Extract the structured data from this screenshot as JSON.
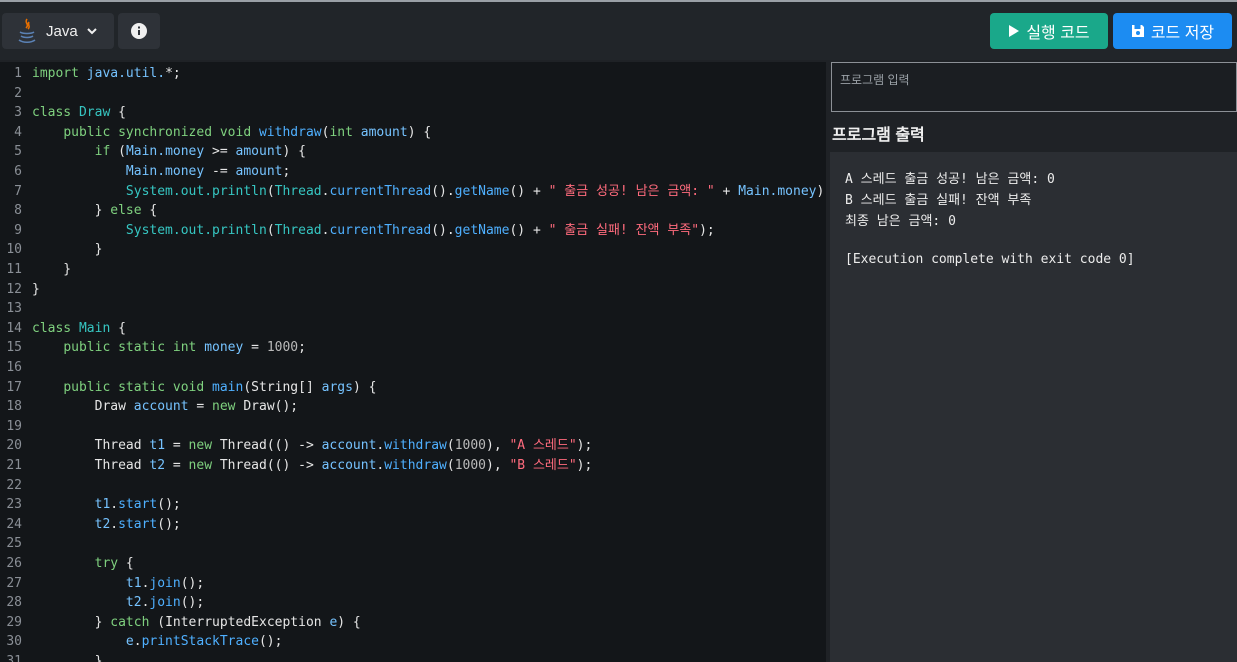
{
  "toolbar": {
    "language": "Java",
    "run_label": "실행 코드",
    "save_label": "코드 저장",
    "colors": {
      "run": "#1aa88a",
      "save": "#1c8cf2"
    }
  },
  "editor": {
    "lines": [
      {
        "n": "1",
        "tokens": [
          [
            "kg",
            "import "
          ],
          [
            "kw",
            "java.util."
          ],
          [
            "op",
            "*;"
          ]
        ]
      },
      {
        "n": "2",
        "tokens": []
      },
      {
        "n": "3",
        "tokens": [
          [
            "kg",
            "class "
          ],
          [
            "cls",
            "Draw"
          ],
          [
            "op",
            " {"
          ]
        ]
      },
      {
        "n": "4",
        "tokens": [
          [
            "op",
            "    "
          ],
          [
            "kg",
            "public synchronized void "
          ],
          [
            "fn",
            "withdraw"
          ],
          [
            "op",
            "("
          ],
          [
            "kg",
            "int "
          ],
          [
            "kw",
            "amount"
          ],
          [
            "op",
            ") {"
          ]
        ]
      },
      {
        "n": "5",
        "tokens": [
          [
            "op",
            "        "
          ],
          [
            "kg",
            "if "
          ],
          [
            "op",
            "("
          ],
          [
            "kw",
            "Main.money"
          ],
          [
            "op",
            " >= "
          ],
          [
            "kw",
            "amount"
          ],
          [
            "op",
            ") {"
          ]
        ]
      },
      {
        "n": "6",
        "tokens": [
          [
            "op",
            "            "
          ],
          [
            "kw",
            "Main.money"
          ],
          [
            "op",
            " -= "
          ],
          [
            "kw",
            "amount"
          ],
          [
            "op",
            ";"
          ]
        ]
      },
      {
        "n": "7",
        "tokens": [
          [
            "op",
            "            "
          ],
          [
            "cls",
            "System.out.println"
          ],
          [
            "op",
            "("
          ],
          [
            "cls",
            "Thread"
          ],
          [
            "op",
            "."
          ],
          [
            "fn",
            "currentThread"
          ],
          [
            "op",
            "()."
          ],
          [
            "fn",
            "getName"
          ],
          [
            "op",
            "() + "
          ],
          [
            "str",
            "\" 출금 성공! 남은 금액: \""
          ],
          [
            "op",
            " + "
          ],
          [
            "kw",
            "Main.money"
          ],
          [
            "op",
            ");"
          ]
        ]
      },
      {
        "n": "8",
        "tokens": [
          [
            "op",
            "        } "
          ],
          [
            "kg",
            "else"
          ],
          [
            "op",
            " {"
          ]
        ]
      },
      {
        "n": "9",
        "tokens": [
          [
            "op",
            "            "
          ],
          [
            "cls",
            "System.out.println"
          ],
          [
            "op",
            "("
          ],
          [
            "cls",
            "Thread"
          ],
          [
            "op",
            "."
          ],
          [
            "fn",
            "currentThread"
          ],
          [
            "op",
            "()."
          ],
          [
            "fn",
            "getName"
          ],
          [
            "op",
            "() + "
          ],
          [
            "str",
            "\" 출금 실패! 잔액 부족\""
          ],
          [
            "op",
            ");"
          ]
        ]
      },
      {
        "n": "10",
        "tokens": [
          [
            "op",
            "        }"
          ]
        ]
      },
      {
        "n": "11",
        "tokens": [
          [
            "op",
            "    }"
          ]
        ]
      },
      {
        "n": "12",
        "tokens": [
          [
            "op",
            "}"
          ]
        ]
      },
      {
        "n": "13",
        "tokens": []
      },
      {
        "n": "14",
        "tokens": [
          [
            "kg",
            "class "
          ],
          [
            "cls",
            "Main"
          ],
          [
            "op",
            " {"
          ]
        ]
      },
      {
        "n": "15",
        "tokens": [
          [
            "op",
            "    "
          ],
          [
            "kg",
            "public static int "
          ],
          [
            "kw",
            "money"
          ],
          [
            "op",
            " = "
          ],
          [
            "num",
            "1000"
          ],
          [
            "op",
            ";"
          ]
        ]
      },
      {
        "n": "16",
        "tokens": []
      },
      {
        "n": "17",
        "tokens": [
          [
            "op",
            "    "
          ],
          [
            "kg",
            "public static void "
          ],
          [
            "fn",
            "main"
          ],
          [
            "op",
            "(String[] "
          ],
          [
            "kw",
            "args"
          ],
          [
            "op",
            ") {"
          ]
        ]
      },
      {
        "n": "18",
        "tokens": [
          [
            "op",
            "        Draw "
          ],
          [
            "kw",
            "account"
          ],
          [
            "op",
            " = "
          ],
          [
            "kg",
            "new "
          ],
          [
            "op",
            "Draw();"
          ]
        ]
      },
      {
        "n": "19",
        "tokens": []
      },
      {
        "n": "20",
        "tokens": [
          [
            "op",
            "        Thread "
          ],
          [
            "kw",
            "t1"
          ],
          [
            "op",
            " = "
          ],
          [
            "kg",
            "new "
          ],
          [
            "op",
            "Thread(() -> "
          ],
          [
            "kw",
            "account"
          ],
          [
            "op",
            "."
          ],
          [
            "fn",
            "withdraw"
          ],
          [
            "op",
            "("
          ],
          [
            "num",
            "1000"
          ],
          [
            "op",
            "), "
          ],
          [
            "str",
            "\"A 스레드\""
          ],
          [
            "op",
            ");"
          ]
        ]
      },
      {
        "n": "21",
        "tokens": [
          [
            "op",
            "        Thread "
          ],
          [
            "kw",
            "t2"
          ],
          [
            "op",
            " = "
          ],
          [
            "kg",
            "new "
          ],
          [
            "op",
            "Thread(() -> "
          ],
          [
            "kw",
            "account"
          ],
          [
            "op",
            "."
          ],
          [
            "fn",
            "withdraw"
          ],
          [
            "op",
            "("
          ],
          [
            "num",
            "1000"
          ],
          [
            "op",
            "), "
          ],
          [
            "str",
            "\"B 스레드\""
          ],
          [
            "op",
            ");"
          ]
        ]
      },
      {
        "n": "22",
        "tokens": []
      },
      {
        "n": "23",
        "tokens": [
          [
            "op",
            "        "
          ],
          [
            "kw",
            "t1"
          ],
          [
            "op",
            "."
          ],
          [
            "fn",
            "start"
          ],
          [
            "op",
            "();"
          ]
        ]
      },
      {
        "n": "24",
        "tokens": [
          [
            "op",
            "        "
          ],
          [
            "kw",
            "t2"
          ],
          [
            "op",
            "."
          ],
          [
            "fn",
            "start"
          ],
          [
            "op",
            "();"
          ]
        ]
      },
      {
        "n": "25",
        "tokens": []
      },
      {
        "n": "26",
        "tokens": [
          [
            "op",
            "        "
          ],
          [
            "kg",
            "try"
          ],
          [
            "op",
            " {"
          ]
        ]
      },
      {
        "n": "27",
        "tokens": [
          [
            "op",
            "            "
          ],
          [
            "kw",
            "t1"
          ],
          [
            "op",
            "."
          ],
          [
            "fn",
            "join"
          ],
          [
            "op",
            "();"
          ]
        ]
      },
      {
        "n": "28",
        "tokens": [
          [
            "op",
            "            "
          ],
          [
            "kw",
            "t2"
          ],
          [
            "op",
            "."
          ],
          [
            "fn",
            "join"
          ],
          [
            "op",
            "();"
          ]
        ]
      },
      {
        "n": "29",
        "tokens": [
          [
            "op",
            "        } "
          ],
          [
            "kg",
            "catch"
          ],
          [
            "op",
            " (InterruptedException "
          ],
          [
            "kw",
            "e"
          ],
          [
            "op",
            ") {"
          ]
        ]
      },
      {
        "n": "30",
        "tokens": [
          [
            "op",
            "            "
          ],
          [
            "kw",
            "e"
          ],
          [
            "op",
            "."
          ],
          [
            "fn",
            "printStackTrace"
          ],
          [
            "op",
            "();"
          ]
        ]
      },
      {
        "n": "31",
        "tokens": [
          [
            "op",
            "        }"
          ]
        ]
      }
    ]
  },
  "input": {
    "placeholder": "프로그램 입력"
  },
  "output": {
    "title": "프로그램 출력",
    "lines": [
      "A 스레드 출금 성공! 남은 금액: 0",
      "B 스레드 출금 실패! 잔액 부족",
      "최종 남은 금액: 0",
      "",
      "[Execution complete with exit code 0]"
    ]
  }
}
